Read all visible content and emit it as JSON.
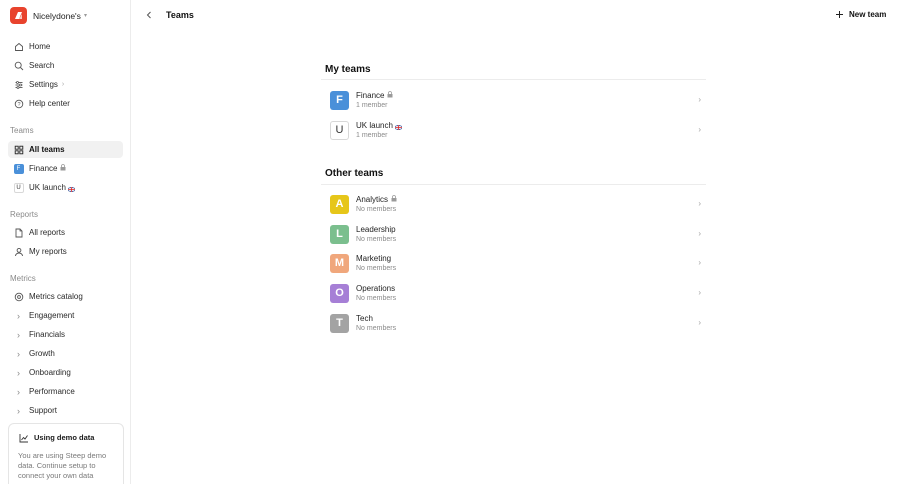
{
  "workspace": {
    "name": "Nicelydone's"
  },
  "sidebar": {
    "nav": [
      {
        "label": "Home"
      },
      {
        "label": "Search"
      },
      {
        "label": "Settings"
      },
      {
        "label": "Help center"
      }
    ],
    "teams_label": "Teams",
    "teams": [
      {
        "label": "All teams"
      },
      {
        "label": "Finance",
        "initial": "F"
      },
      {
        "label": "UK launch",
        "initial": "U"
      }
    ],
    "reports_label": "Reports",
    "reports": [
      {
        "label": "All reports"
      },
      {
        "label": "My reports"
      }
    ],
    "metrics_label": "Metrics",
    "metrics": [
      {
        "label": "Metrics catalog"
      },
      {
        "label": "Engagement"
      },
      {
        "label": "Financials"
      },
      {
        "label": "Growth"
      },
      {
        "label": "Onboarding"
      },
      {
        "label": "Performance"
      },
      {
        "label": "Support"
      }
    ],
    "demo": {
      "title": "Using demo data",
      "text": "You are using Steep demo data. Continue setup to connect your own data source."
    }
  },
  "header": {
    "title": "Teams",
    "new_team_label": "New team"
  },
  "my_teams": {
    "title": "My teams",
    "items": [
      {
        "initial": "F",
        "name": "Finance",
        "sub": "1 member",
        "color": "#4a90d9"
      },
      {
        "initial": "U",
        "name": "UK launch",
        "sub": "1 member",
        "color": "#ffffff"
      }
    ]
  },
  "other_teams": {
    "title": "Other teams",
    "items": [
      {
        "initial": "A",
        "name": "Analytics",
        "sub": "No members",
        "color": "#e6c619"
      },
      {
        "initial": "L",
        "name": "Leadership",
        "sub": "No members",
        "color": "#7bbf8e"
      },
      {
        "initial": "M",
        "name": "Marketing",
        "sub": "No members",
        "color": "#f0a77c"
      },
      {
        "initial": "O",
        "name": "Operations",
        "sub": "No members",
        "color": "#a67fd6"
      },
      {
        "initial": "T",
        "name": "Tech",
        "sub": "No members",
        "color": "#a3a3a3"
      }
    ]
  },
  "colors": {
    "brand": "#e8432d",
    "active_bg": "#f1f1f1"
  }
}
